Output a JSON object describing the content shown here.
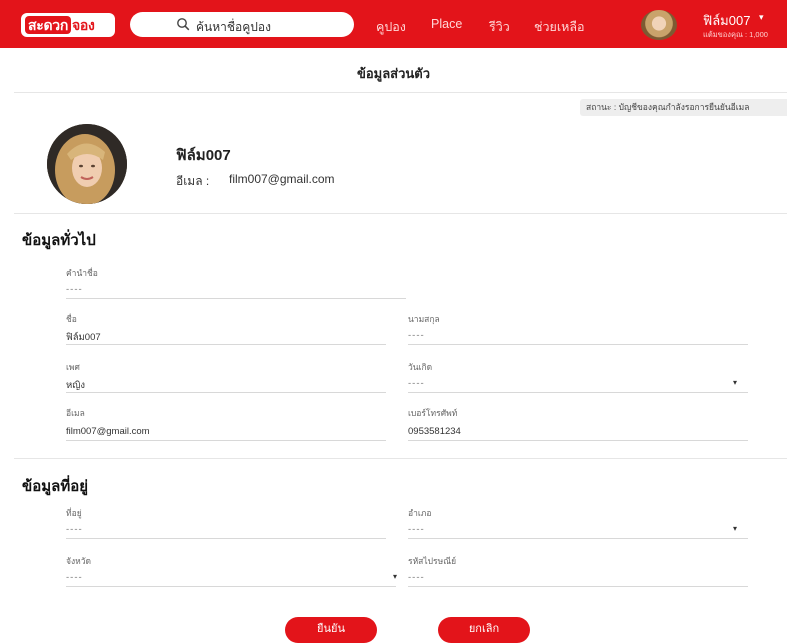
{
  "header": {
    "logo_part1": "สะดวก",
    "logo_part2": "จอง",
    "search_placeholder": "ค้นหาชื่อคูปอง",
    "nav": [
      "คูปอง",
      "Place",
      "รีวิว",
      "ช่วยเหลือ"
    ],
    "user_name": "ฟิล์ม007",
    "user_caret": "▾",
    "points": "แต้มของคุณ : 1,000"
  },
  "page": {
    "title": "ข้อมูลส่วนตัว",
    "status": "สถานะ : บัญชีของคุณกำลังรอการยืนยันอีเมล"
  },
  "profile": {
    "name": "ฟิล์ม007",
    "email_label": "อีเมล :",
    "email": "film007@gmail.com"
  },
  "general": {
    "title": "ข้อมูลทั่วไป",
    "prefix_label": "คำนำชื่อ",
    "prefix_value": "----",
    "first_name_label": "ชื่อ",
    "first_name_value": "ฟิล์ม007",
    "last_name_label": "นามสกุล",
    "last_name_value": "----",
    "gender_label": "เพศ",
    "gender_value": "หญิง",
    "birthday_label": "วันเกิด",
    "birthday_value": "----",
    "email_label": "อีเมล",
    "email_value": "film007@gmail.com",
    "phone_label": "เบอร์โทรศัพท์",
    "phone_value": "0953581234"
  },
  "address": {
    "title": "ข้อมูลที่อยู่",
    "address_label": "ที่อยู่",
    "address_value": "----",
    "district_label": "อำเภอ",
    "district_value": "----",
    "province_label": "จังหวัด",
    "province_value": "----",
    "postal_label": "รหัสไปรษณีย์",
    "postal_value": "----"
  },
  "actions": {
    "confirm": "ยืนยัน",
    "cancel": "ยกเลิก"
  },
  "icons": {
    "dropdown": "▾"
  },
  "colors": {
    "brand": "#e3141a"
  }
}
